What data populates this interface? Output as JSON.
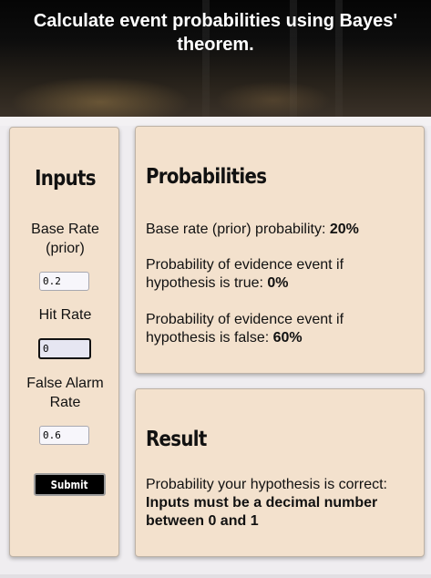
{
  "header": {
    "title": "Calculate event probabilities using Bayes' theorem."
  },
  "inputs": {
    "heading": "Inputs",
    "base_rate": {
      "label": "Base Rate (prior)",
      "value": "0.2"
    },
    "hit_rate": {
      "label": "Hit Rate",
      "value": "0"
    },
    "false_alarm_rate": {
      "label": "False Alarm Rate",
      "value": "0.6"
    },
    "submit_label": "Submit"
  },
  "probabilities": {
    "heading": "Probabilities",
    "base_rate_text": "Base rate (prior) probability: ",
    "base_rate_value": "20%",
    "true_text": "Probability of evidence event if hypothesis is true: ",
    "true_value": "0%",
    "false_text": "Probability of evidence event if hypothesis is false: ",
    "false_value": "60%"
  },
  "result": {
    "heading": "Result",
    "text": "Probability your hypothesis is correct: ",
    "value": "Inputs must be a decimal number between 0 and 1"
  }
}
